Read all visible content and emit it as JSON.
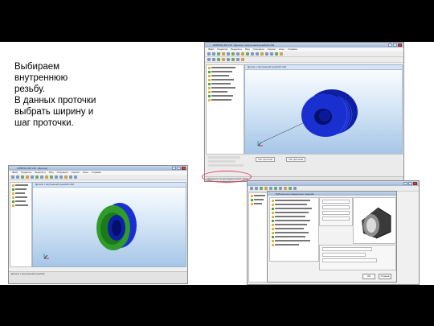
{
  "caption": {
    "text": "Выбираем\nвнутреннюю\nрезьбу.\nВ данных проточки\nвыбрать ширину и\nшаг проточки."
  },
  "colors": {
    "part_blue": "#1a2fd0",
    "part_green": "#2e9b2a",
    "highlight": "#e0405a",
    "window_frame": "#8a8a8a"
  },
  "window_top_right": {
    "title": "КОМПАС-3D V13 - [Деталь с внутренней резьбой.m3d]",
    "menu": [
      "Файл",
      "Редактор",
      "Выделить",
      "Вид",
      "Операции",
      "Сервис",
      "Окно",
      "Справка"
    ],
    "viewport_title": "Деталь с внутренней резьбой.m3d",
    "prop_buttons": [
      "Тип проточки",
      "Тип проточки"
    ],
    "status": "Щелкните на цилиндрической грани"
  },
  "window_bottom_left": {
    "title": "КОМПАС-3D V13 - [Деталь]",
    "menu": [
      "Файл",
      "Редактор",
      "Выделить",
      "Вид",
      "Операции",
      "Сервис",
      "Окно",
      "Справка"
    ],
    "viewport_title": "Деталь с внутренней резьбой.m3d",
    "status": "Деталь с внутренней резьбой"
  },
  "dialog_bottom_right": {
    "title": "Библиотека стандартных изделий",
    "buttons": [
      "OK",
      "Отмена"
    ]
  }
}
